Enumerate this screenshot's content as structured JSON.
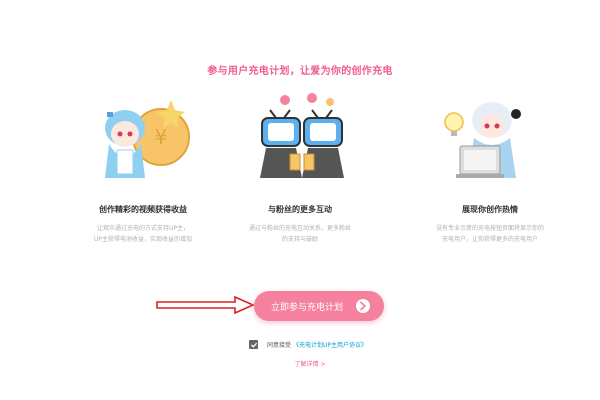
{
  "header": {
    "title": "参与用户充电计划，让爱为你的创作充电"
  },
  "features": [
    {
      "title": "创作精彩的视频获得收益",
      "desc_line1": "让观众通过充电的方式支持UP主，",
      "desc_line2": "UP主获得电池收益，实现收益的增加",
      "icon": "anime-girl-with-coin"
    },
    {
      "title": "与粉丝的更多互动",
      "desc_line1": "通过与粉丝的充电互动关系，更多粉丝",
      "desc_line2": "的支持与鼓励",
      "icon": "tv-mascots-cheers"
    },
    {
      "title": "展现你创作热情",
      "desc_line1": "没有专业示意的充电按钮页面将显示你的",
      "desc_line2": "充电用户，让你获得更多的充电用户",
      "icon": "anime-girl-at-laptop-with-bulb"
    }
  ],
  "cta": {
    "label": "立即参与充电计划",
    "icon": "arrow-right-circle-icon",
    "color": "#f5819f"
  },
  "agreement": {
    "checked": true,
    "prefix": "同意接受",
    "link": "《充电计划UP主用户协议》"
  },
  "learn_more": "了解详情 >",
  "colors": {
    "accent": "#f25d8e",
    "link": "#00a1d6",
    "annotation_arrow": "#e02020"
  }
}
